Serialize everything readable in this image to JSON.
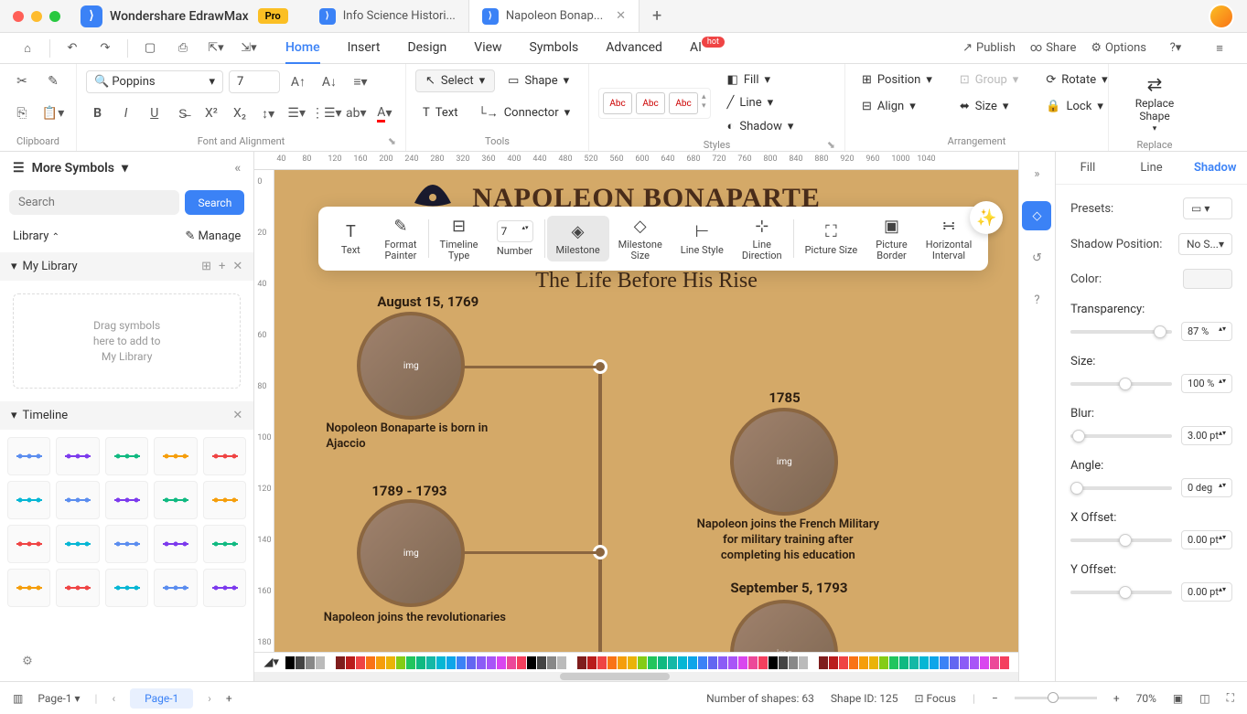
{
  "app": {
    "name": "Wondershare EdrawMax",
    "pro": "Pro"
  },
  "tabs": [
    {
      "label": "Info Science Histori..."
    },
    {
      "label": "Napoleon Bonap..."
    }
  ],
  "menu": {
    "items": [
      "Home",
      "Insert",
      "Design",
      "View",
      "Symbols",
      "Advanced",
      "AI"
    ],
    "publish": "Publish",
    "share": "Share",
    "options": "Options"
  },
  "ribbon": {
    "clipboard": "Clipboard",
    "font": "Poppins",
    "size": "7",
    "font_align": "Font and Alignment",
    "select": "Select",
    "shape": "Shape",
    "text": "Text",
    "connector": "Connector",
    "tools": "Tools",
    "style_label": "Abc",
    "styles": "Styles",
    "fill": "Fill",
    "line": "Line",
    "shadow": "Shadow",
    "position": "Position",
    "align": "Align",
    "group": "Group",
    "size_l": "Size",
    "rotate": "Rotate",
    "lock": "Lock",
    "arrangement": "Arrangement",
    "replace_shape": "Replace\nShape",
    "replace": "Replace"
  },
  "sidebar": {
    "more": "More Symbols",
    "search_ph": "Search",
    "search_btn": "Search",
    "library": "Library",
    "manage": "Manage",
    "mylib": "My Library",
    "dropzone": "Drag symbols\nhere to add to\nMy Library",
    "timeline": "Timeline"
  },
  "floating": {
    "text": "Text",
    "format_painter": "Format\nPainter",
    "timeline_type": "Timeline\nType",
    "number_val": "7",
    "number": "Number",
    "milestone": "Milestone",
    "milestone_size": "Milestone\nSize",
    "line_style": "Line Style",
    "line_direction": "Line\nDirection",
    "picture_size": "Picture Size",
    "picture_border": "Picture\nBorder",
    "horizontal_interval": "Horizontal\nInterval"
  },
  "canvas": {
    "title": "NAPOLEON BONAPARTE",
    "sub": "The Life Before His Rise",
    "m1_date": "August 15, 1769",
    "m1_desc": "Nopoleon Bonaparte is born in Ajaccio",
    "m2_date": "1785",
    "m2_desc": "Napoleon joins the French Military for military training after completing his education",
    "m3_date": "1789 - 1793",
    "m3_desc": "Napoleon joins the revolutionaries",
    "m4_date": "September 5, 1793"
  },
  "ruler_h": [
    "40",
    "80",
    "120",
    "160",
    "200",
    "240",
    "280",
    "320",
    "360",
    "400",
    "440",
    "480",
    "520",
    "560",
    "600",
    "640",
    "680",
    "720",
    "760",
    "800",
    "840",
    "880",
    "920",
    "960",
    "1000",
    "1040"
  ],
  "ruler_v": [
    "0",
    "20",
    "40",
    "60",
    "80",
    "100",
    "120",
    "140",
    "160",
    "180"
  ],
  "right_icons": {
    "expand": "»"
  },
  "panel": {
    "fill": "Fill",
    "line": "Line",
    "shadow": "Shadow",
    "presets": "Presets:",
    "shadow_pos": "Shadow Position:",
    "shadow_pos_val": "No S...",
    "color": "Color:",
    "transparency": "Transparency:",
    "transparency_val": "87 %",
    "size": "Size:",
    "size_val": "100 %",
    "blur": "Blur:",
    "blur_val": "3.00 pt",
    "angle": "Angle:",
    "angle_val": "0 deg",
    "xoffset": "X Offset:",
    "xoffset_val": "0.00 pt",
    "yoffset": "Y Offset:",
    "yoffset_val": "0.00 pt"
  },
  "status": {
    "page_sel": "Page-1",
    "page_tab": "Page-1",
    "plus": "+",
    "shapes": "Number of shapes: 63",
    "shape_id": "Shape ID: 125",
    "focus": "Focus",
    "zoom": "70%"
  }
}
